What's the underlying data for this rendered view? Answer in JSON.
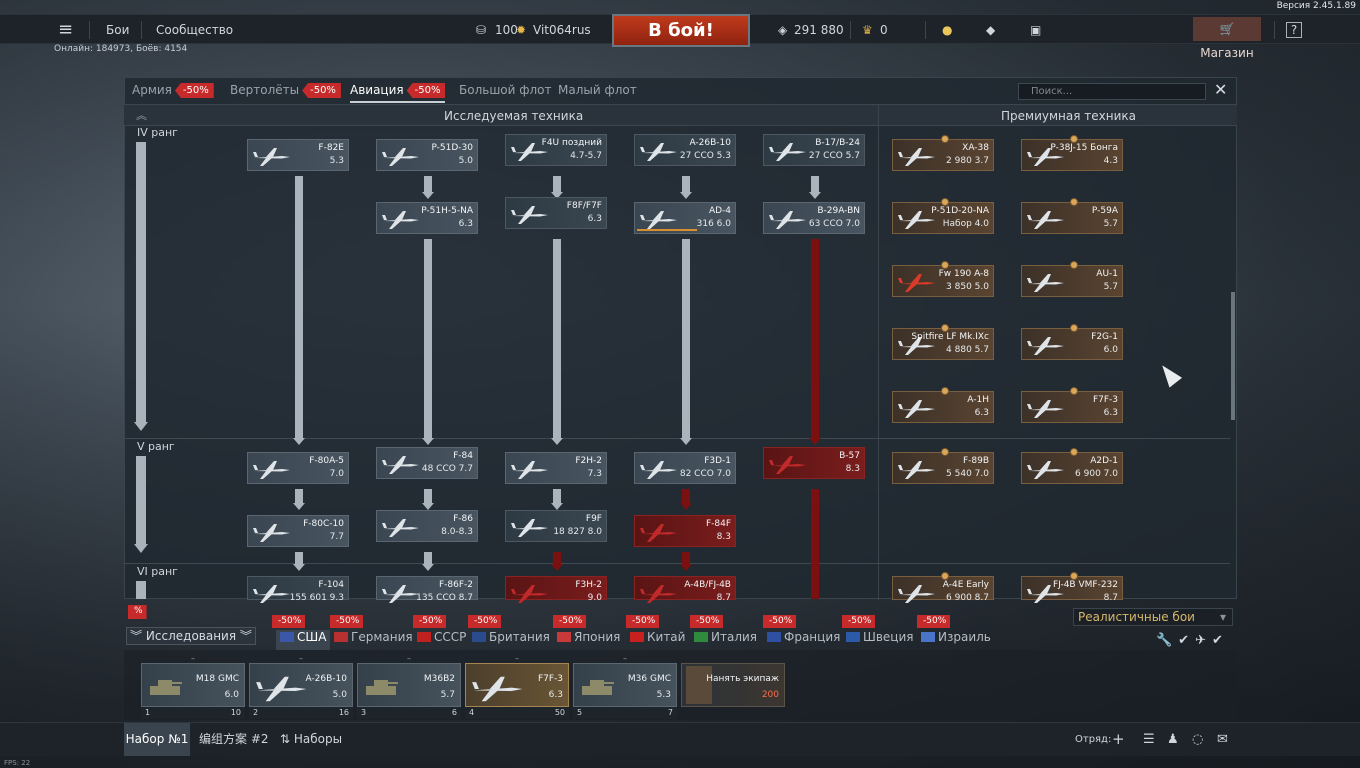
{
  "version": "Версия 2.45.1.89",
  "topbar": {
    "menu_icon": "hamburger-icon",
    "battles": "Бои",
    "community": "Сообщество",
    "gold": "100",
    "username": "Vit064rus",
    "to_battle": "В бой!",
    "silver": "291 880",
    "eagles": "0",
    "shop": "Магазин",
    "help": "?"
  },
  "online": "Онлайн: 184973, Боёв: 4154",
  "tabs": [
    {
      "label": "Армия",
      "discount": "-50%"
    },
    {
      "label": "Вертолёты",
      "discount": "-50%"
    },
    {
      "label": "Авиация",
      "discount": "-50%",
      "active": true
    },
    {
      "label": "Большой флот"
    },
    {
      "label": "Малый флот"
    }
  ],
  "search": {
    "placeholder": "Поиск..."
  },
  "headers": {
    "researchable": "Исследуемая техника",
    "premium": "Премиумная техника"
  },
  "ranks": [
    "IV ранг",
    "V ранг",
    "VI ранг"
  ],
  "tree": [
    {
      "name": "F-82E",
      "info": "5.3"
    },
    {
      "name": "P-51D-30",
      "info": "5.0"
    },
    {
      "name": "F4U поздний",
      "info": "4.7-5.7"
    },
    {
      "name": "A-26B-10",
      "info": "27 ССО 5.3"
    },
    {
      "name": "B-17/B-24",
      "info": "27 ССО 5.7"
    },
    {
      "name": "P-51H-5-NA",
      "info": "6.3"
    },
    {
      "name": "F8F/F7F",
      "info": "6.3"
    },
    {
      "name": "AD-4",
      "info": "316 6.0",
      "progress": 0.6
    },
    {
      "name": "B-29A-BN",
      "info": "63 ССО 7.0"
    },
    {
      "name": "F-80A-5",
      "info": "7.0"
    },
    {
      "name": "F-84",
      "info": "48 ССО 7.7"
    },
    {
      "name": "F2H-2",
      "info": "7.3"
    },
    {
      "name": "F3D-1",
      "info": "82 ССО 7.0"
    },
    {
      "name": "B-57",
      "info": "8.3"
    },
    {
      "name": "F-80C-10",
      "info": "7.7"
    },
    {
      "name": "F-86",
      "info": "8.0-8.3"
    },
    {
      "name": "F9F",
      "info": "18 827 8.0"
    },
    {
      "name": "F-84F",
      "info": "8.3"
    },
    {
      "name": "F-104",
      "info": "155 601 9.3"
    },
    {
      "name": "F-86F-2",
      "info": "135 ССО 8.7"
    },
    {
      "name": "F3H-2",
      "info": "9.0"
    },
    {
      "name": "A-4B/FJ-4B",
      "info": "8.7"
    }
  ],
  "premium": [
    {
      "name": "XA-38",
      "info": "2 980 3.7"
    },
    {
      "name": "P-38J-15 Бонга",
      "info": "4.3"
    },
    {
      "name": "P-51D-20-NA",
      "info": "Набор 4.0"
    },
    {
      "name": "P-59A",
      "info": "5.7"
    },
    {
      "name": "Fw 190 A-8",
      "info": "3 850 5.0"
    },
    {
      "name": "AU-1",
      "info": "5.7"
    },
    {
      "name": "Spitfire LF Mk.IXc",
      "info": "4 880 5.7"
    },
    {
      "name": "F2G-1",
      "info": "6.0"
    },
    {
      "name": "A-1H",
      "info": "6.3"
    },
    {
      "name": "F7F-3",
      "info": "6.3"
    },
    {
      "name": "F-89B",
      "info": "5 540 7.0"
    },
    {
      "name": "A2D-1",
      "info": "6 900 7.0"
    },
    {
      "name": "A-4E Early",
      "info": "6 900 8.7"
    },
    {
      "name": "FJ-4B VMF-232",
      "info": "8.7"
    }
  ],
  "mode": "Реалистичные бои",
  "research_label": "Исследования",
  "nations": [
    {
      "label": "США",
      "discount": "-50%",
      "active": true,
      "color": "#3a57a8"
    },
    {
      "label": "Германия",
      "discount": "-50%",
      "color": "#b83030"
    },
    {
      "label": "СССР",
      "discount": "-50%",
      "color": "#c0201e"
    },
    {
      "label": "Британия",
      "discount": "-50%",
      "color": "#2a4c8c"
    },
    {
      "label": "Япония",
      "discount": "-50%",
      "color": "#c83a3a"
    },
    {
      "label": "Китай",
      "discount": "-50%",
      "color": "#c8201e"
    },
    {
      "label": "Италия",
      "discount": "-50%",
      "color": "#2f8a3e"
    },
    {
      "label": "Франция",
      "discount": "-50%",
      "color": "#2f4fa0"
    },
    {
      "label": "Швеция",
      "discount": "-50%",
      "color": "#2a5aa8"
    },
    {
      "label": "Израиль",
      "discount": "-50%",
      "color": "#4a74c8"
    }
  ],
  "crew": [
    {
      "name": "M18 GMC",
      "br": "6.0",
      "num": "1",
      "val": "10"
    },
    {
      "name": "A-26B-10",
      "br": "5.0",
      "num": "2",
      "val": "16"
    },
    {
      "name": "M36B2",
      "br": "5.7",
      "num": "3",
      "val": "6"
    },
    {
      "name": "F7F-3",
      "br": "6.3",
      "num": "4",
      "val": "50",
      "selected": true
    },
    {
      "name": "M36 GMC",
      "br": "5.3",
      "num": "5",
      "val": "7"
    }
  ],
  "hire": {
    "label": "Нанять экипаж",
    "cost": "200"
  },
  "bottom": {
    "preset1": "Набор №1",
    "preset2": "编组方案 #2",
    "presets": "Наборы",
    "squad": "Отряд:"
  },
  "fps": "FPS: 22"
}
